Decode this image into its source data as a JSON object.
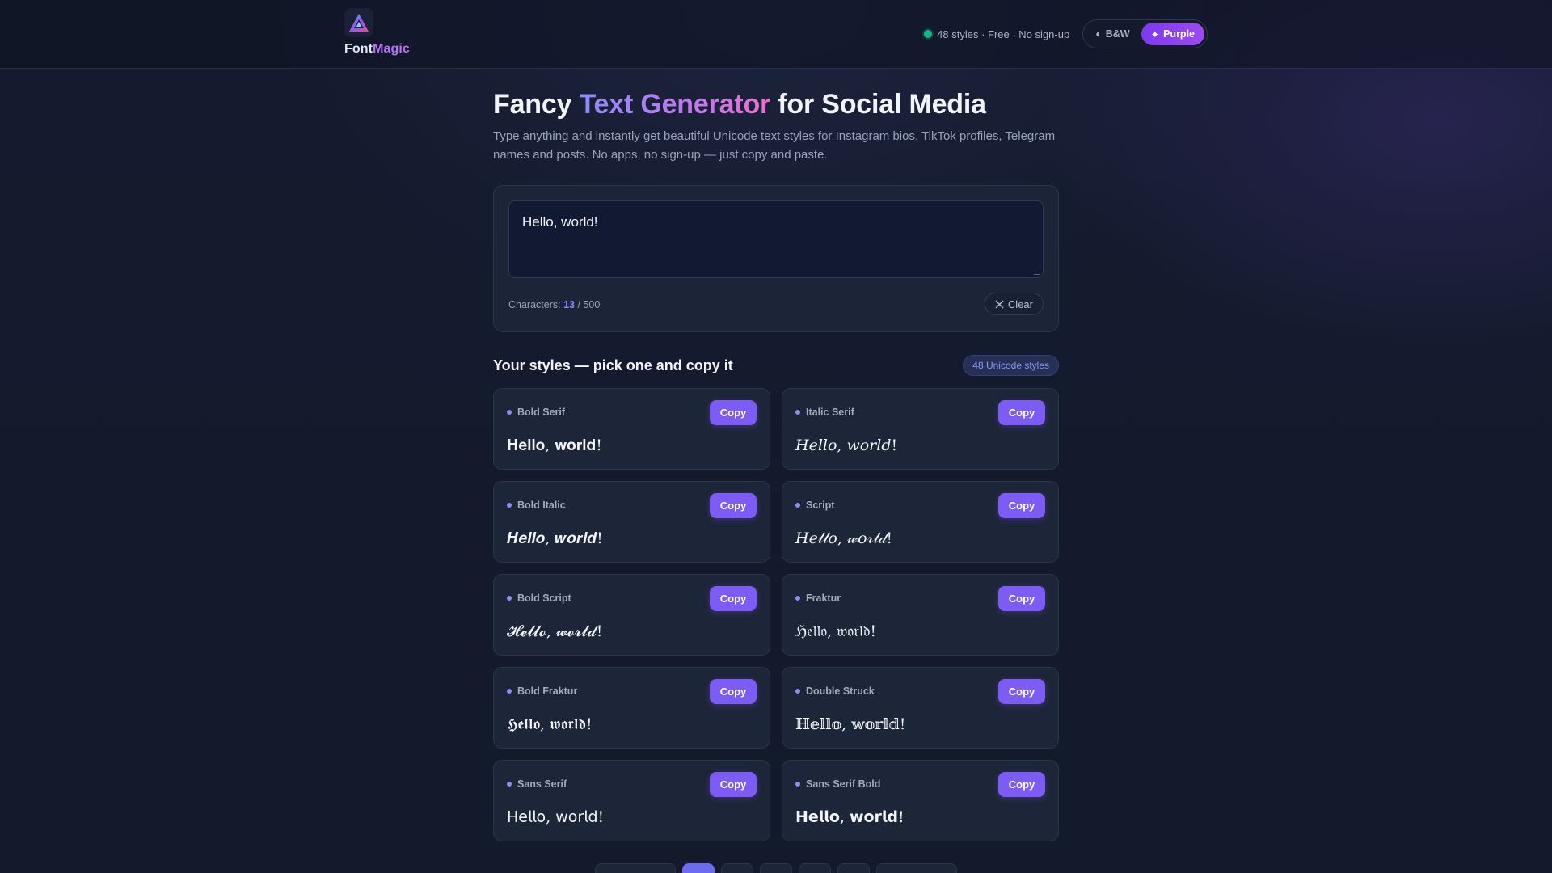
{
  "header": {
    "logo_part1": "Font",
    "logo_part2": "Magic",
    "status_text": "48 styles · Free · No sign-up",
    "theme_bw_label": "B&W",
    "theme_purple_label": "Purple",
    "theme_bw_icon": "half-circle-icon",
    "theme_purple_icon": "sparkle-icon"
  },
  "hero": {
    "title_part1": "Fancy ",
    "title_highlight": "Text Generator",
    "title_part2": " for Social Media",
    "subtitle": "Type anything and instantly get beautiful Unicode text styles for Instagram bios, TikTok profiles, Telegram names and posts. No apps, no sign-up — just copy and paste."
  },
  "input": {
    "value": "Hello, world!",
    "char_label": "Characters: ",
    "char_count": "13",
    "char_max": " / 500",
    "clear_label": "Clear"
  },
  "styles_section": {
    "title": "Your styles — pick one and copy it",
    "badge": "48 Unicode styles",
    "copy_label": "Copy",
    "items": [
      {
        "label": "Bold Serif",
        "sample": "𝐇𝐞𝐥𝐥𝐨, 𝐰𝐨𝐫𝐥𝐝!"
      },
      {
        "label": "Italic Serif",
        "sample": "𝐻𝑒𝑙𝑙𝑜, 𝑤𝑜𝑟𝑙𝑑!"
      },
      {
        "label": "Bold Italic",
        "sample": "𝑯𝒆𝒍𝒍𝒐, 𝒘𝒐𝒓𝒍𝒅!"
      },
      {
        "label": "Script",
        "sample": "𝐻𝑒𝓁𝓁𝑜, 𝓌𝑜𝓇𝓁𝒹!"
      },
      {
        "label": "Bold Script",
        "sample": "𝓗𝓮𝓵𝓵𝓸, 𝔀𝓸𝓻𝓵𝓭!"
      },
      {
        "label": "Fraktur",
        "sample": "ℌ𝔢𝔩𝔩𝔬, 𝔴𝔬𝔯𝔩𝔡!"
      },
      {
        "label": "Bold Fraktur",
        "sample": "𝕳𝖊𝖑𝖑𝖔, 𝖜𝖔𝖗𝖑𝖉!"
      },
      {
        "label": "Double Struck",
        "sample": "ℍ𝕖𝕝𝕝𝕠, 𝕨𝕠𝕣𝕝𝕕!"
      },
      {
        "label": "Sans Serif",
        "sample": "𝖧𝖾𝗅𝗅𝗈, 𝗐𝗈𝗋𝗅𝖽!"
      },
      {
        "label": "Sans Serif Bold",
        "sample": "𝗛𝗲𝗹𝗹𝗼, 𝘄𝗼𝗿𝗹𝗱!"
      }
    ]
  },
  "colors": {
    "accent": "#7c5cf5",
    "status_dot": "#10b981",
    "background": "#141b2d"
  }
}
